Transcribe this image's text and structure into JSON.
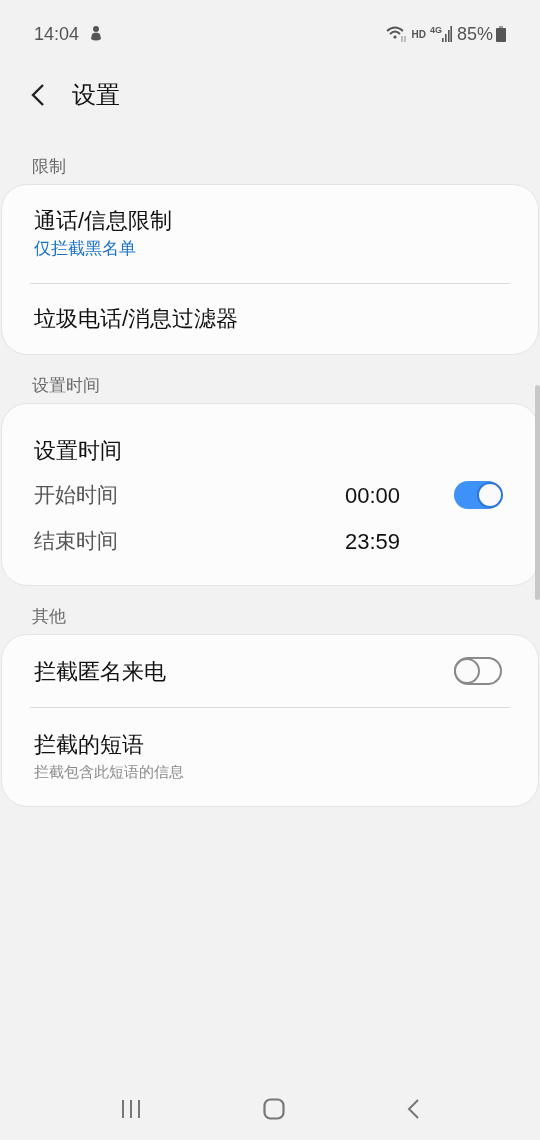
{
  "status_bar": {
    "time": "14:04",
    "hd": "HD",
    "network": "4G",
    "battery": "85%"
  },
  "header": {
    "title": "设置"
  },
  "sections": [
    {
      "title": "限制",
      "items": [
        {
          "kind": "nav",
          "title": "通话/信息限制",
          "subtitle": "仅拦截黑名单",
          "accent": true
        },
        {
          "kind": "nav",
          "title": "垃圾电话/消息过滤器"
        }
      ]
    },
    {
      "title": "设置时间",
      "items": [
        {
          "kind": "schedule",
          "title": "设置时间",
          "on": true,
          "rows": [
            {
              "label": "开始时间",
              "value": "00:00"
            },
            {
              "label": "结束时间",
              "value": "23:59"
            }
          ]
        }
      ]
    },
    {
      "title": "其他",
      "items": [
        {
          "kind": "switch",
          "title": "拦截匿名来电",
          "on": false
        },
        {
          "kind": "nav",
          "title": "拦截的短语",
          "subtitle": "拦截包含此短语的信息",
          "accent": false
        }
      ]
    }
  ]
}
